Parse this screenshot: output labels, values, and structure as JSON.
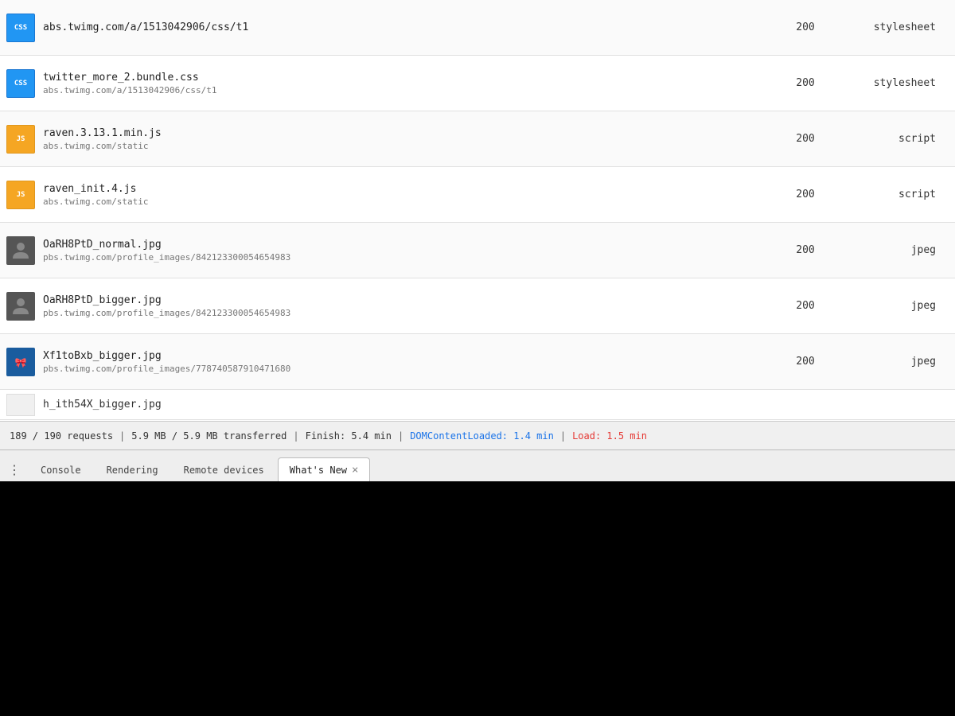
{
  "rows": [
    {
      "icon_type": "css",
      "icon_label": "CSS",
      "file_name": "abs.twimg.com/a/1513042906/css/t1",
      "file_url": "",
      "status": "200",
      "type": "stylesheet"
    },
    {
      "icon_type": "css",
      "icon_label": "CSS",
      "file_name": "twitter_more_2.bundle.css",
      "file_url": "abs.twimg.com/a/1513042906/css/t1",
      "status": "200",
      "type": "stylesheet"
    },
    {
      "icon_type": "js",
      "icon_label": "JS",
      "file_name": "raven.3.13.1.min.js",
      "file_url": "abs.twimg.com/static",
      "status": "200",
      "type": "script"
    },
    {
      "icon_type": "js",
      "icon_label": "JS",
      "file_name": "raven_init.4.js",
      "file_url": "abs.twimg.com/static",
      "status": "200",
      "type": "script"
    },
    {
      "icon_type": "img_person",
      "icon_label": "👤",
      "file_name": "OaRH8PtD_normal.jpg",
      "file_url": "pbs.twimg.com/profile_images/842123300054654983",
      "status": "200",
      "type": "jpeg"
    },
    {
      "icon_type": "img_person",
      "icon_label": "👤",
      "file_name": "OaRH8PtD_bigger.jpg",
      "file_url": "pbs.twimg.com/profile_images/842123300054654983",
      "status": "200",
      "type": "jpeg"
    },
    {
      "icon_type": "img_blue",
      "icon_label": "🎀",
      "file_name": "Xf1toBxb_bigger.jpg",
      "file_url": "pbs.twimg.com/profile_images/778740587910471680",
      "status": "200",
      "type": "jpeg"
    }
  ],
  "partial_row": {
    "file_name": "h_ith54X_bigger.jpg"
  },
  "status_bar": {
    "requests": "189 / 190 requests",
    "transferred": "5.9 MB / 5.9 MB transferred",
    "finish": "Finish: 5.4 min",
    "dom": "DOMContentLoaded: 1.4 min",
    "load": "Load: 1.5 min"
  },
  "tabs": {
    "more_icon": "⋮",
    "items": [
      {
        "label": "Console",
        "active": false,
        "closeable": false
      },
      {
        "label": "Rendering",
        "active": false,
        "closeable": false
      },
      {
        "label": "Remote devices",
        "active": false,
        "closeable": false
      },
      {
        "label": "What's New",
        "active": true,
        "closeable": true
      }
    ]
  }
}
